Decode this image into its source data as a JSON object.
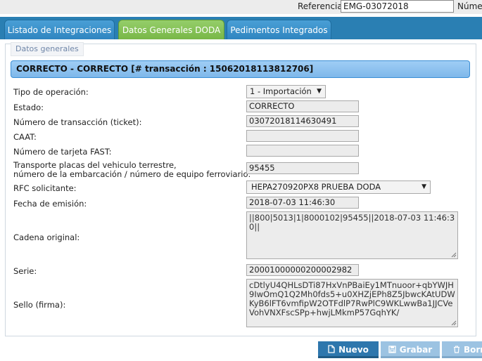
{
  "header": {
    "referencia_label": "Referencia:",
    "referencia_value": "EMG-03072018",
    "numero_label": "Númer"
  },
  "tabs": [
    {
      "label": "Listado de Integraciones",
      "active": false
    },
    {
      "label": "Datos Generales DODA",
      "active": true
    },
    {
      "label": "Pedimentos Integrados",
      "active": false
    }
  ],
  "panel": {
    "legend": "Datos generales",
    "status_banner": "CORRECTO - CORRECTO [# transacción : 15062018113812706]"
  },
  "form": {
    "tipo_operacion": {
      "label": "Tipo de operación:",
      "value": "1 - Importación"
    },
    "estado": {
      "label": "Estado:",
      "value": "CORRECTO"
    },
    "num_transaccion": {
      "label": "Número de transacción (ticket):",
      "value": "03072018114630491"
    },
    "caat": {
      "label": "CAAT:",
      "value": ""
    },
    "tarjeta_fast": {
      "label": "Número de tarjeta FAST:",
      "value": ""
    },
    "transporte": {
      "label_line1": "Transporte placas del vehiculo terrestre,",
      "label_line2": "número de la embarcación / número de equipo ferroviario:",
      "value": "95455"
    },
    "rfc": {
      "label": "RFC solicitante:",
      "value": "HEPA270920PX8 PRUEBA DODA"
    },
    "fecha_emision": {
      "label": "Fecha de emisión:",
      "value": "2018-07-03 11:46:30"
    },
    "cadena_original": {
      "label": "Cadena original:",
      "value": "||800|5013|1|8000102|95455||2018-07-03 11:46:30||"
    },
    "serie": {
      "label": "Serie:",
      "value": "20001000000200002982"
    },
    "sello": {
      "label": "Sello (firma):",
      "value": "cDtlyU4QHLsDTi87HxVnPBaiEy1MTnuoor+qbYWJH9IwOmQ1Q2Mh0fds5+u0XHZjEPh8Z5JbwcKAtUDWKyB6lFT6vmfipW2OTFdlP7RwPlC9WKLwwBa1JJCVeVohVNXFscSPp+hwjLMkmP57GqhYK/"
    }
  },
  "buttons": {
    "nuevo": "Nuevo",
    "grabar": "Grabar",
    "borrar": "Borr"
  },
  "colors": {
    "tab_bar": "#2a7fb3",
    "active_tab": "#78b747",
    "banner": "#8cc2ef",
    "primary_button": "#2e77ad"
  },
  "icons": {
    "nuevo": "document-icon",
    "grabar": "save-icon",
    "borrar": "trash-icon"
  }
}
